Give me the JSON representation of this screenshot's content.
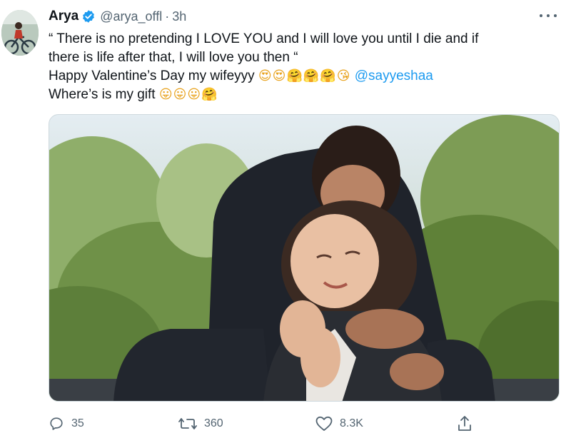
{
  "author": {
    "name": "Arya",
    "handle": "@arya_offl",
    "separator": "·",
    "time": "3h",
    "verified": true
  },
  "tweet": {
    "line1": "“ There is no pretending I LOVE YOU and I will love you until I die and if",
    "line2": "there is life after that, I will love you then “",
    "line3_text": "Happy Valentine’s Day my wifeyyy",
    "line3_emoji": "😍😍🤗🤗🤗😘",
    "mention": "@sayyeshaa",
    "line4_text": "Where’s is my gift",
    "line4_emoji": "😛😛😛🤗"
  },
  "actions": {
    "replies": "35",
    "retweets": "360",
    "likes": "8.3K"
  },
  "colors": {
    "verified": "#1d9bf0",
    "mention": "#1d9bf0",
    "secondary_text": "#536471"
  },
  "icons": [
    "verified-badge-icon",
    "more-options-icon",
    "reply-icon",
    "retweet-icon",
    "like-icon",
    "share-icon"
  ]
}
